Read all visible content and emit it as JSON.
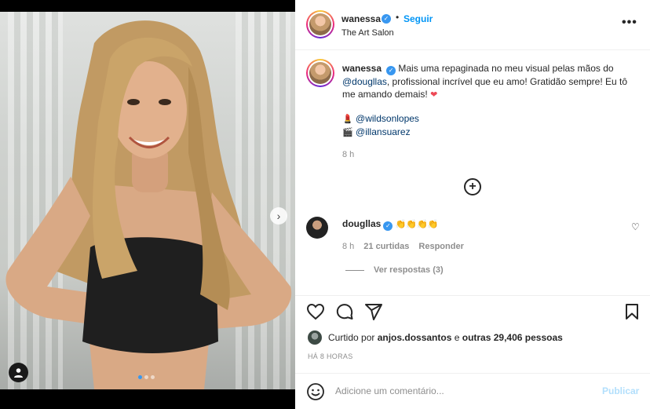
{
  "post": {
    "author": "wanessa",
    "follow_label": "Seguir",
    "separator": "•",
    "location": "The Art Salon",
    "more_label": "•••",
    "carousel": {
      "current": 1,
      "total": 3
    }
  },
  "caption": {
    "username": "wanessa",
    "text_before": "Mais uma repaginada no meu visual pelas mãos do ",
    "mention": "@dougllas",
    "text_after": ", profissional incrível que eu amo! Gratidão sempre! Eu tô me amando demais! ",
    "heart": "❤",
    "credit1_emoji": "💄",
    "credit1": "@wildsonlopes",
    "credit2_emoji": "🎬",
    "credit2": "@illansuarez",
    "time": "8 h"
  },
  "load_more_label": "+",
  "comment": {
    "username": "dougllas",
    "text": "👏👏👏👏",
    "time": "8 h",
    "likes": "21 curtidas",
    "reply_label": "Responder",
    "view_replies": "Ver respostas (3)"
  },
  "likes": {
    "prefix": "Curtido por ",
    "user": "anjos.dossantos",
    "middle": " e ",
    "others": "outras 29,406 pessoas"
  },
  "age": "HÁ 8 HORAS",
  "add_comment": {
    "placeholder": "Adicione um comentário...",
    "publish_label": "Publicar"
  },
  "colors": {
    "accent": "#0095f6",
    "verified": "#3897f0",
    "heart": "#ed4956",
    "muted": "#8e8e8e"
  }
}
